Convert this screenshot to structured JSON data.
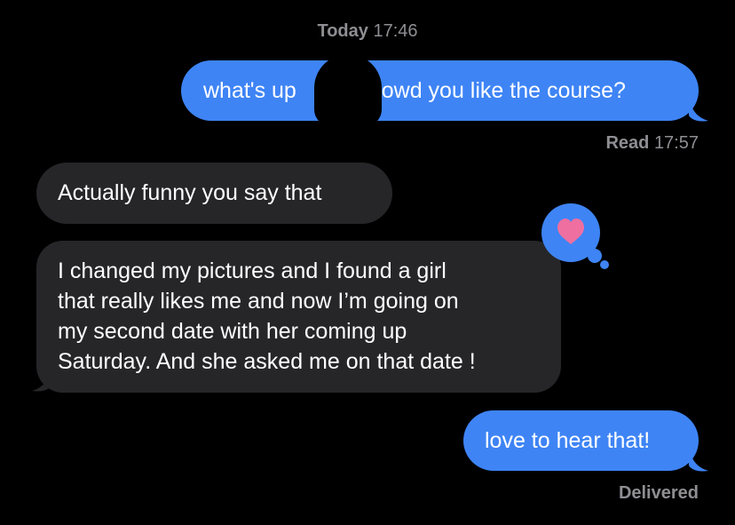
{
  "header": {
    "day": "Today",
    "time": "17:46"
  },
  "messages": [
    {
      "direction": "sent",
      "text_before": "what's up",
      "text_after": "howd you like the course?"
    },
    {
      "direction": "received",
      "text": "Actually funny you say that"
    },
    {
      "direction": "received",
      "lines": [
        "I changed my pictures and I found a girl",
        "that really likes me and now I’m going on",
        "my second date with her coming up",
        "Saturday. And she asked me on that date !"
      ]
    },
    {
      "direction": "sent",
      "text": "love to hear that!"
    }
  ],
  "receipts": {
    "read_label": "Read",
    "read_time": "17:57",
    "delivered": "Delivered"
  },
  "reaction": {
    "icon": "heart-icon",
    "color": "#ee6fa0",
    "bubble_color": "#3e84f5"
  },
  "colors": {
    "sent": "#3e84f5",
    "received": "#262629",
    "meta": "#8e8e93"
  }
}
